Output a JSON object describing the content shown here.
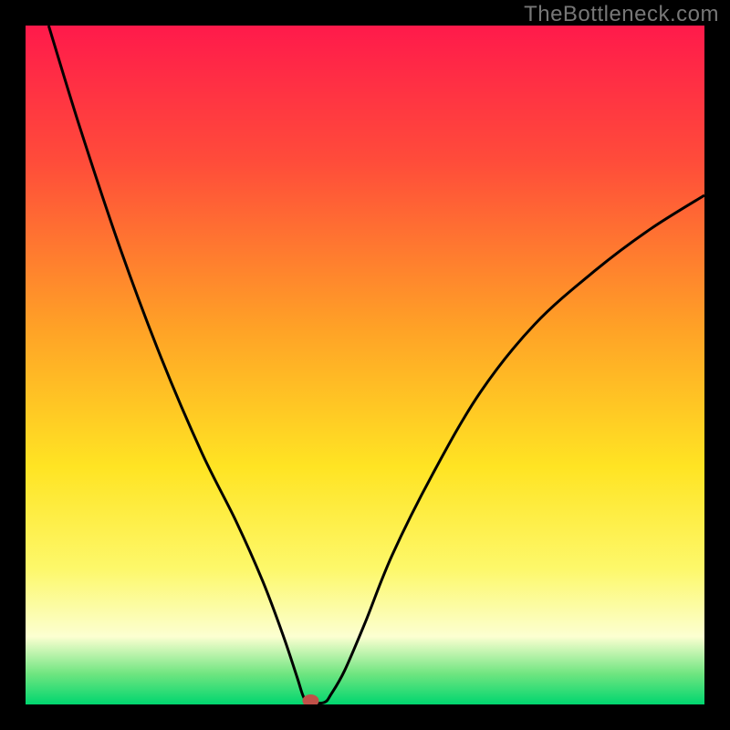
{
  "watermark": "TheBottleneck.com",
  "chart_data": {
    "type": "line",
    "title": "",
    "xlabel": "",
    "ylabel": "",
    "xlim": [
      0,
      100
    ],
    "ylim": [
      0,
      100
    ],
    "grid": false,
    "legend": false,
    "line_color": "#000000",
    "marker": {
      "x": 42,
      "y": 0,
      "color": "#c05048"
    },
    "gradient_stops": [
      {
        "offset": 0.0,
        "color": "#ff1a4b"
      },
      {
        "offset": 0.2,
        "color": "#ff4c3a"
      },
      {
        "offset": 0.45,
        "color": "#ffa326"
      },
      {
        "offset": 0.65,
        "color": "#ffe423"
      },
      {
        "offset": 0.8,
        "color": "#fdf86a"
      },
      {
        "offset": 0.9,
        "color": "#fcffd1"
      },
      {
        "offset": 0.955,
        "color": "#6fe580"
      },
      {
        "offset": 1.0,
        "color": "#00d66f"
      }
    ],
    "series": [
      {
        "name": "curve",
        "points": [
          {
            "x": 3.4,
            "y": 100.0
          },
          {
            "x": 8.0,
            "y": 85.0
          },
          {
            "x": 14.0,
            "y": 67.0
          },
          {
            "x": 20.0,
            "y": 51.0
          },
          {
            "x": 26.0,
            "y": 37.0
          },
          {
            "x": 31.0,
            "y": 27.0
          },
          {
            "x": 35.0,
            "y": 18.0
          },
          {
            "x": 38.0,
            "y": 10.0
          },
          {
            "x": 40.0,
            "y": 4.0
          },
          {
            "x": 41.0,
            "y": 1.0
          },
          {
            "x": 42.0,
            "y": 0.3
          },
          {
            "x": 44.0,
            "y": 0.3
          },
          {
            "x": 45.0,
            "y": 1.5
          },
          {
            "x": 47.0,
            "y": 5.0
          },
          {
            "x": 50.0,
            "y": 12.0
          },
          {
            "x": 54.0,
            "y": 22.0
          },
          {
            "x": 60.0,
            "y": 34.0
          },
          {
            "x": 67.0,
            "y": 46.0
          },
          {
            "x": 75.0,
            "y": 56.0
          },
          {
            "x": 84.0,
            "y": 64.0
          },
          {
            "x": 92.0,
            "y": 70.0
          },
          {
            "x": 100.0,
            "y": 75.0
          }
        ]
      }
    ]
  }
}
